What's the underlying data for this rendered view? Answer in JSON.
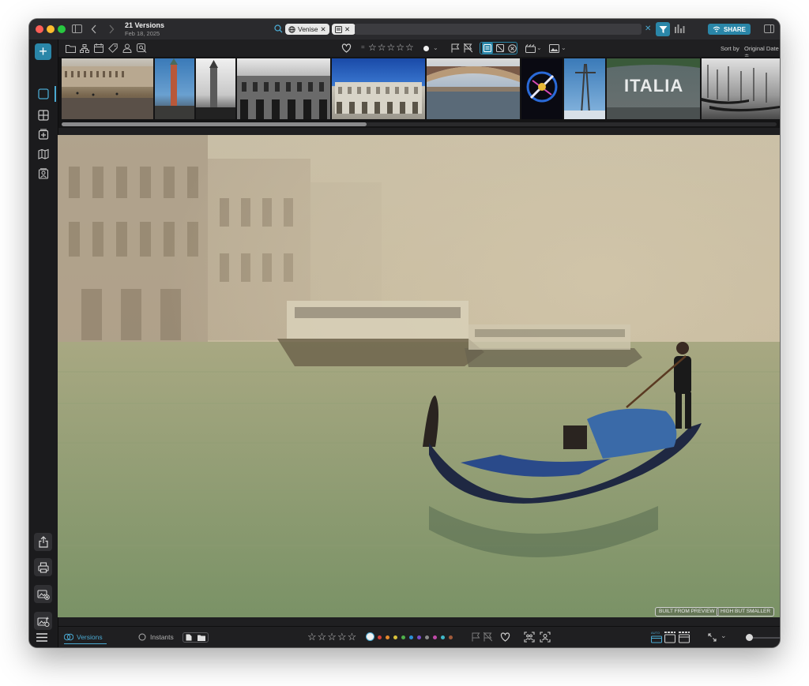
{
  "window": {
    "title": "21 Versions",
    "date": "Feb 18, 2025"
  },
  "search": {
    "chip_label": "Venise",
    "value": ""
  },
  "toolbar": {
    "share_label": "SHARE",
    "rating_stars": "☆☆☆☆☆",
    "sort_label": "Sort by",
    "sort_value": "Original Date ≑"
  },
  "filmstrip": {
    "items": [
      "St Mark's Square",
      "Campanile",
      "Campanile B&W",
      "Palace facade B&W",
      "Doge's Palace",
      "Rialto bridge",
      "Neon sign",
      "Crane",
      "ITALIA",
      "Gondolas B&W"
    ],
    "itaia_text": "ITALIA"
  },
  "preview": {
    "badge_left": "BUILT FROM PREVIEW",
    "badge_right": "HIGH BUT SMALLER"
  },
  "bottom": {
    "tab_versions": "Versions",
    "tab_instants": "Instants",
    "rating_stars": "☆☆☆☆☆",
    "color_labels": [
      "#d8403a",
      "#e58a2c",
      "#d9c23a",
      "#4fb04a",
      "#2c8fd6",
      "#7b4fc9",
      "#8a8a8a",
      "#c04aa8",
      "#3fb8c9",
      "#a05a3a"
    ]
  },
  "colors": {
    "accent": "#2a86a8",
    "window_bg": "#1f1f21"
  }
}
